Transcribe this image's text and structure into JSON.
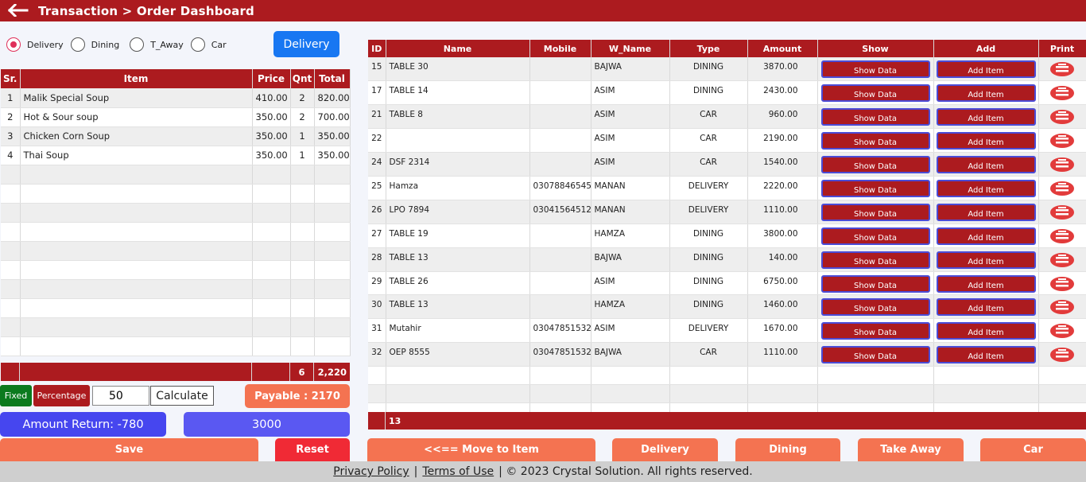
{
  "header": {
    "title": "Transaction > Order Dashboard"
  },
  "order_types": {
    "options": [
      "Delivery",
      "Dining",
      "T_Away",
      "Car"
    ],
    "selected": "Delivery",
    "button_label": "Delivery"
  },
  "items_table": {
    "headers": [
      "Sr.",
      "Item",
      "Price",
      "Qnt",
      "Total"
    ],
    "rows": [
      {
        "sr": "1",
        "item": "Malik Special Soup",
        "price": "410.00",
        "qnt": "2",
        "total": "820.00"
      },
      {
        "sr": "2",
        "item": "Hot & Sour soup",
        "price": "350.00",
        "qnt": "2",
        "total": "700.00"
      },
      {
        "sr": "3",
        "item": "Chicken Corn Soup",
        "price": "350.00",
        "qnt": "1",
        "total": "350.00"
      },
      {
        "sr": "4",
        "item": "Thai Soup",
        "price": "350.00",
        "qnt": "1",
        "total": "350.00"
      }
    ],
    "blank_rows": 10,
    "footer": {
      "qnt": "6",
      "total": "2,220"
    }
  },
  "discount": {
    "fixed_label": "Fixed",
    "percentage_label": "Percentage",
    "value": "50",
    "calculate_label": "Calculate"
  },
  "payable": "Payable : 2170",
  "amount_return": "Amount Return: -780",
  "cash_received": "3000",
  "buttons": {
    "save": "Save",
    "reset": "Reset",
    "move": "<<== Move to Item",
    "delivery": "Delivery",
    "dining": "Dining",
    "take_away": "Take Away",
    "car": "Car"
  },
  "orders_table": {
    "headers": [
      "ID",
      "Name",
      "Mobile",
      "W_Name",
      "Type",
      "Amount",
      "Show",
      "Add",
      "Print"
    ],
    "show_label": "Show Data",
    "add_label": "Add Item",
    "rows": [
      {
        "id": "15",
        "name": "TABLE 30",
        "mobile": "",
        "w_name": "BAJWA",
        "type": "DINING",
        "amount": "3870.00"
      },
      {
        "id": "17",
        "name": "TABLE 14",
        "mobile": "",
        "w_name": "ASIM",
        "type": "DINING",
        "amount": "2430.00"
      },
      {
        "id": "21",
        "name": "TABLE 8",
        "mobile": "",
        "w_name": "ASIM",
        "type": "CAR",
        "amount": "960.00"
      },
      {
        "id": "22",
        "name": "",
        "mobile": "",
        "w_name": "ASIM",
        "type": "CAR",
        "amount": "2190.00"
      },
      {
        "id": "24",
        "name": "DSF 2314",
        "mobile": "",
        "w_name": "ASIM",
        "type": "CAR",
        "amount": "1540.00"
      },
      {
        "id": "25",
        "name": "Hamza",
        "mobile": "03078846545",
        "w_name": "MANAN",
        "type": "DELIVERY",
        "amount": "2220.00"
      },
      {
        "id": "26",
        "name": "LPO 7894",
        "mobile": "03041564512",
        "w_name": "MANAN",
        "type": "DELIVERY",
        "amount": "1110.00"
      },
      {
        "id": "27",
        "name": "TABLE 19",
        "mobile": "",
        "w_name": "HAMZA",
        "type": "DINING",
        "amount": "3800.00"
      },
      {
        "id": "28",
        "name": "TABLE 13",
        "mobile": "",
        "w_name": "BAJWA",
        "type": "DINING",
        "amount": "140.00"
      },
      {
        "id": "29",
        "name": "TABLE 26",
        "mobile": "",
        "w_name": "ASIM",
        "type": "DINING",
        "amount": "6750.00"
      },
      {
        "id": "30",
        "name": "TABLE 13",
        "mobile": "",
        "w_name": "HAMZA",
        "type": "DINING",
        "amount": "1460.00"
      },
      {
        "id": "31",
        "name": "Mutahir",
        "mobile": "03047851532",
        "w_name": "ASIM",
        "type": "DELIVERY",
        "amount": "1670.00"
      },
      {
        "id": "32",
        "name": "OEP 8555",
        "mobile": "03047851532",
        "w_name": "BAJWA",
        "type": "CAR",
        "amount": "1110.00"
      }
    ],
    "blank_rows": 3,
    "footer_count": "13"
  },
  "footer": {
    "privacy": "Privacy Policy",
    "divider": "|",
    "terms": "Terms of Use",
    "copyright": "| © 2023 Crystal Solution. All rights reserved."
  },
  "colors": {
    "brand_red": "#ac1b1f",
    "coral": "#f47351",
    "primary_blue": "#1877f2",
    "return_blue": "#4646ef",
    "fixed_green": "#0b7a1e",
    "reset_red": "#f02a35"
  }
}
